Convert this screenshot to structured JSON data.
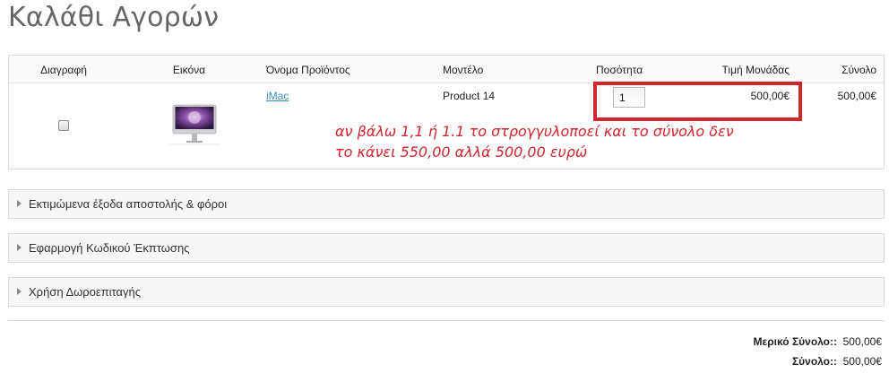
{
  "page": {
    "title": "Καλάθι Αγορών"
  },
  "cart": {
    "headers": {
      "remove": "Διαγραφή",
      "image": "Εικόνα",
      "name": "Όνομα Προϊόντος",
      "model": "Μοντέλο",
      "quantity": "Ποσότητα",
      "unit_price": "Τιμή Μονάδας",
      "total": "Σύνολο"
    },
    "items": [
      {
        "name": "iMac",
        "model": "Product 14",
        "quantity": "1",
        "unit_price": "500,00€",
        "total": "500,00€"
      }
    ]
  },
  "annotation": {
    "line1": "αν βάλω 1,1 ή 1.1 το στρογγυλοποεί και το σύνολο δεν",
    "line2": "το κάνει 550,00 αλλά 500,00 ευρώ",
    "color": "#d3262c"
  },
  "panels": [
    {
      "title": "Εκτιμώμενα έξοδα αποστολής & φόροι"
    },
    {
      "title": "Εφαρμογή Κωδικού Έκπτωσης"
    },
    {
      "title": "Χρήση Δωροεπιταγής"
    }
  ],
  "summary": {
    "subtotal_label": "Μερικό Σύνολο::",
    "subtotal_value": "500,00€",
    "total_label": "Σύνολο::",
    "total_value": "500,00€"
  }
}
